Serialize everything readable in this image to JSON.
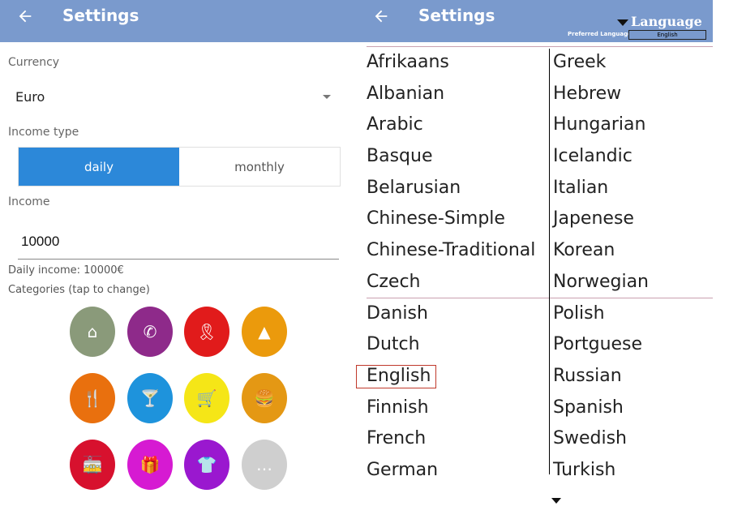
{
  "left": {
    "title": "Settings",
    "currency": {
      "label": "Currency",
      "value": "Euro"
    },
    "income_type": {
      "label": "Income type",
      "options": [
        "daily",
        "monthly"
      ],
      "selected": "daily"
    },
    "income": {
      "label": "Income",
      "value": "10000"
    },
    "daily_income": "Daily income: 10000€",
    "categories_label": "Categories (tap to change)",
    "categories": [
      {
        "icon": "home-icon",
        "color": "#8a9a7a",
        "glyph": "⌂"
      },
      {
        "icon": "phone-icon",
        "color": "#8e2a8a",
        "glyph": "✆"
      },
      {
        "icon": "ribbon-icon",
        "color": "#e11b1b",
        "glyph": "🎗"
      },
      {
        "icon": "cone-icon",
        "color": "#eb9a0c",
        "glyph": "▲"
      },
      {
        "icon": "restaurant-icon",
        "color": "#e9700e",
        "glyph": "🍴"
      },
      {
        "icon": "cocktail-icon",
        "color": "#1e93dc",
        "glyph": "🍸"
      },
      {
        "icon": "cart-icon",
        "color": "#f5e617",
        "glyph": "🛒"
      },
      {
        "icon": "fastfood-icon",
        "color": "#e49814",
        "glyph": "🍔"
      },
      {
        "icon": "tram-icon",
        "color": "#d7112e",
        "glyph": "🚋"
      },
      {
        "icon": "gift-icon",
        "color": "#d61ad2",
        "glyph": "🎁"
      },
      {
        "icon": "shirt-icon",
        "color": "#9a18cf",
        "glyph": "👕"
      },
      {
        "icon": "more-icon",
        "color": "#cfcfcf",
        "glyph": "…"
      }
    ]
  },
  "right": {
    "title": "Settings",
    "language_header": "Language",
    "preferred_language_label": "Preferred Language:",
    "preferred_language_value": "English",
    "languages_col1": [
      "Afrikaans",
      "Albanian",
      "Arabic",
      "Basque",
      "Belarusian",
      "Chinese-Simple",
      "Chinese-Traditional",
      "Czech",
      "Danish",
      "Dutch",
      "English",
      "Finnish",
      "French",
      "German"
    ],
    "languages_col2": [
      "Greek",
      "Hebrew",
      "Hungarian",
      "Icelandic",
      "Italian",
      "Japenese",
      "Korean",
      "Norwegian",
      "Polish",
      "Portguese",
      "Russian",
      "Spanish",
      "Swedish",
      "Turkish"
    ],
    "selected": "English"
  }
}
